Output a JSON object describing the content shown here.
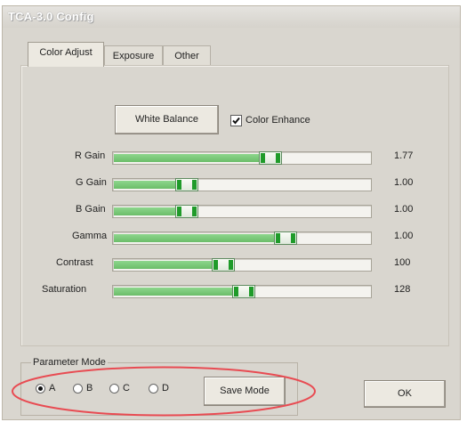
{
  "window": {
    "title": "TCA-3.0 Config"
  },
  "tabs": [
    {
      "label": "Color Adjust",
      "active": true
    },
    {
      "label": "Exposure",
      "active": false
    },
    {
      "label": "Other",
      "active": false
    }
  ],
  "controls": {
    "white_balance_label": "White Balance",
    "color_enhance": {
      "label": "Color Enhance",
      "checked": true
    }
  },
  "sliders": [
    {
      "label": "R Gain",
      "value": "1.77",
      "fill": 0.6
    },
    {
      "label": "G Gain",
      "value": "1.00",
      "fill": 0.28
    },
    {
      "label": "B Gain",
      "value": "1.00",
      "fill": 0.28
    },
    {
      "label": "Gamma",
      "value": "1.00",
      "fill": 0.66
    },
    {
      "label": "Contrast",
      "value": "100",
      "fill": 0.42
    },
    {
      "label": "Saturation",
      "value": "128",
      "fill": 0.5
    }
  ],
  "parameter_mode": {
    "label": "Parameter Mode",
    "options": [
      {
        "label": "A",
        "selected": true
      },
      {
        "label": "B",
        "selected": false
      },
      {
        "label": "C",
        "selected": false
      },
      {
        "label": "D",
        "selected": false
      }
    ],
    "save_mode_label": "Save Mode"
  },
  "ok_label": "OK",
  "colors": {
    "annotation_circle": "#e84b52",
    "slider_green": "#6bbd69",
    "thumb_green": "#1f9b2a"
  }
}
